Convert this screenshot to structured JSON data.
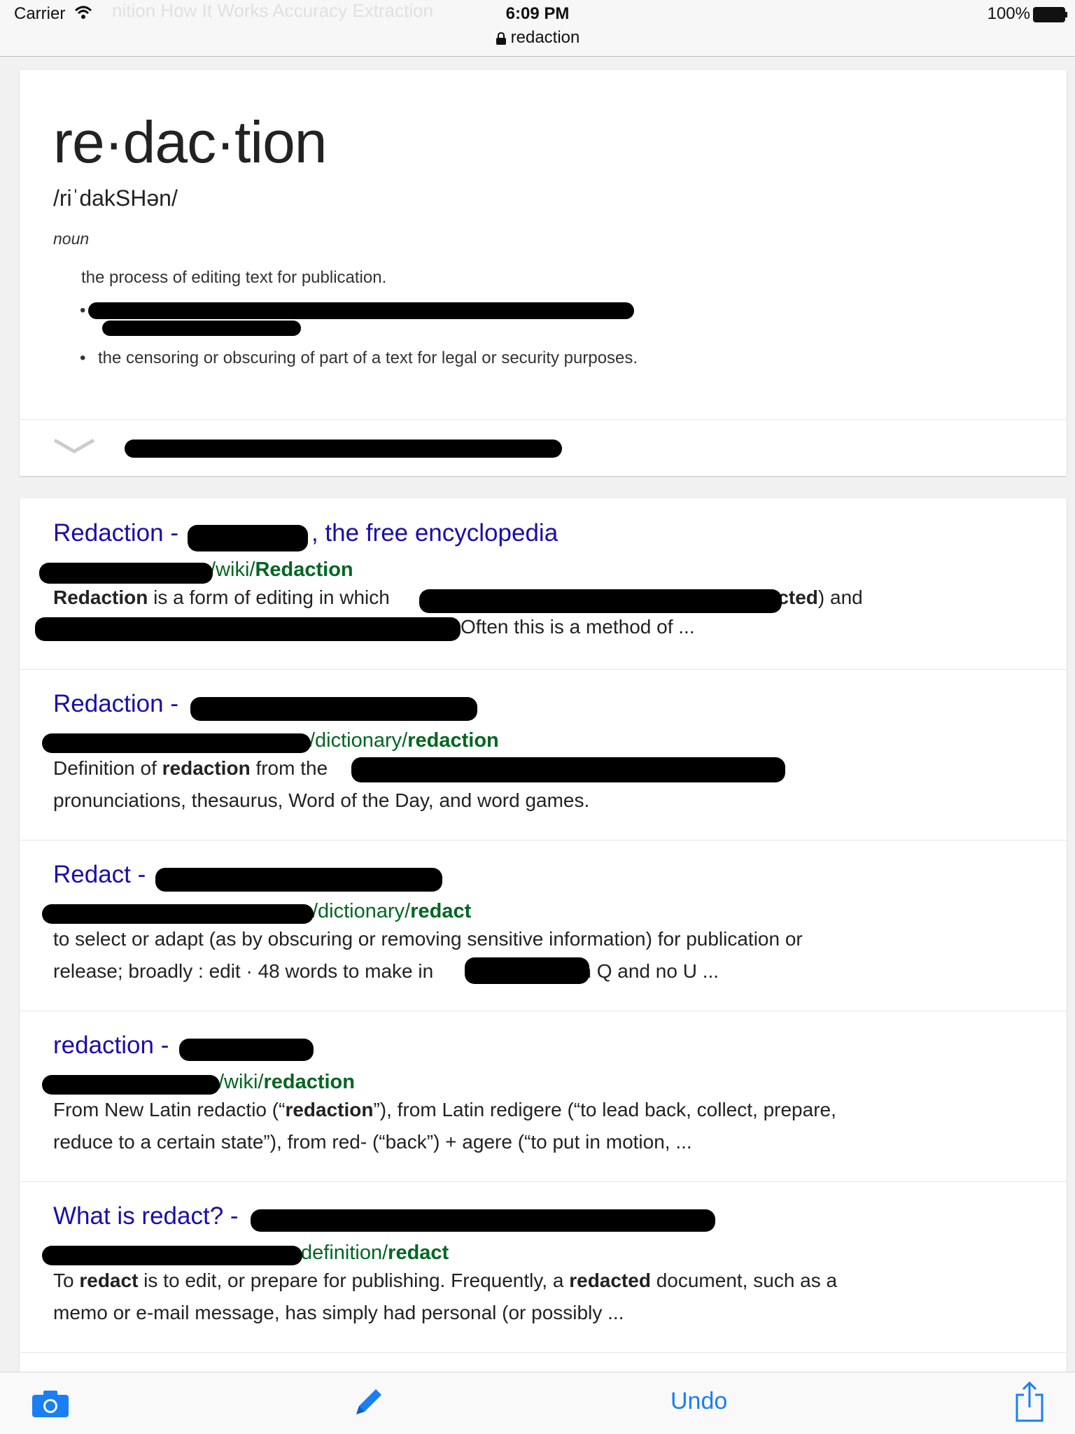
{
  "status_bar": {
    "carrier": "Carrier",
    "time": "6:09 PM",
    "url": "redaction",
    "battery": "100%",
    "faded_tabs": "nition   How It Works   Accuracy   Extraction"
  },
  "dictionary": {
    "headword": "re·dac·tion",
    "phonetic": "/riˈdakSHən/",
    "part_of_speech": "noun",
    "definition_1": "the process of editing text for publication.",
    "definition_3": "the censoring or obscuring of part of a text for legal or security purposes."
  },
  "results": [
    {
      "title_start": "Redaction -",
      "title_end": ", the free encyclopedia",
      "url_path": "/wiki/",
      "url_bold": "Redaction",
      "s1_bold": "Redaction",
      "s1_text": " is a form of editing in which",
      "s1_paren": "(",
      "s1_bold2": "redacted",
      "s1_end": ") and",
      "s2_text": "Often this is a method of ..."
    },
    {
      "title_start": "Redaction -",
      "url_path": "/dictionary/",
      "url_bold": "redaction",
      "s1_text": "Definition of ",
      "s1_bold": "redaction",
      "s1_end": " from the",
      "s2_text": "pronunciations, thesaurus, Word of the Day, and word games."
    },
    {
      "title_start": "Redact -",
      "url_path": "/dictionary/",
      "url_bold": "redact",
      "s1_text": "to select or adapt (as by obscuring or removing sensitive information) for publication or",
      "s2_text": "release; broadly : edit · 48 words to make in",
      "s2_end": "with Q and no U ..."
    },
    {
      "title_start": "redaction -",
      "url_path": "/wiki/",
      "url_bold": "redaction",
      "s1_text": "From New Latin redactio (“",
      "s1_bold": "redaction",
      "s1_end": "”), from Latin redigere (“to lead back, collect, prepare,",
      "s2_text": "reduce to a certain state”), from red- (“back”) + agere (“to put in motion, ..."
    },
    {
      "title_start": "What is redact? -",
      "url_path": "definition/",
      "url_bold": "redact",
      "s1_text": "To ",
      "s1_bold": "redact",
      "s1_mid": " is to edit, or prepare for publishing. Frequently, a ",
      "s1_bold2": "redacted",
      "s1_end": " document, such as a",
      "s2_text": "memo or e-mail message, has simply had personal (or possibly ..."
    }
  ],
  "toolbar": {
    "undo_label": "Undo",
    "camera_icon": "camera-icon",
    "pencil_icon": "pencil-icon",
    "share_icon": "share-icon",
    "accent_color": "#1a7ef5"
  }
}
